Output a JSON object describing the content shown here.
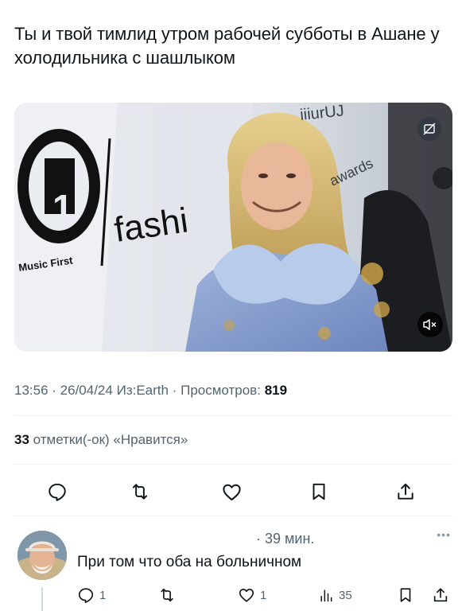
{
  "tweet": {
    "text": "Ты и твой тимлид утром рабочей субботы в Ашане у холодильника с шашлыком",
    "time": "13:56",
    "date": "26/04/24",
    "source": "Из:Earth",
    "views_label": "Просмотров:",
    "views_count": "819",
    "likes_count": "33",
    "likes_label": "отметки(-ок) «Нравится»"
  },
  "media": {
    "logo_text": "VH",
    "logo_number": "1",
    "logo_tagline": "Music First",
    "banner_text": "fashi",
    "banner_top_text": "iiiurUJ",
    "banner_right_text": "awards"
  },
  "reply": {
    "time": "39 мин.",
    "more": "•••",
    "text": "При том что оба на больничном",
    "reply_count": "1",
    "like_count": "1",
    "views_count": "35"
  },
  "colors": {
    "text": "#0f1419",
    "secondary": "#536471",
    "divider": "#eff3f4"
  },
  "icons": [
    "reply-icon",
    "retweet-icon",
    "like-icon",
    "bookmark-icon",
    "share-icon",
    "mute-icon",
    "sensitive-badge-icon",
    "views-icon"
  ]
}
